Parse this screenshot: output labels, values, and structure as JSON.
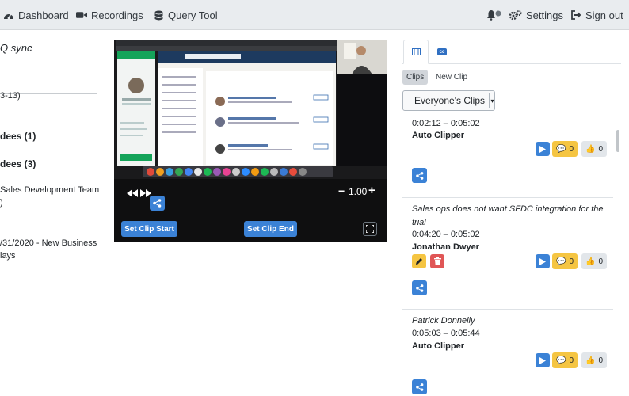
{
  "nav": {
    "dashboard": "Dashboard",
    "recordings": "Recordings",
    "query_tool": "Query Tool",
    "settings": "Settings",
    "sign_out": "Sign out"
  },
  "left_panel": {
    "sync_label": "Q sync",
    "date_range": "3-13)",
    "attendees_1": "dees (1)",
    "attendees_3": "dees (3)",
    "team": "Sales Development Team",
    "team_cont": ")",
    "opportunity": "/31/2020 - New Business",
    "opportunity_cont": "lays"
  },
  "player": {
    "speed": "1.00",
    "set_clip_start": "Set Clip Start",
    "set_clip_end": "Set Clip End"
  },
  "right_panel": {
    "tabs": [
      "clips-tab",
      "captions-tab"
    ],
    "captions_tab_label": "cc",
    "pill_clips": "Clips",
    "pill_new_clip": "New Clip",
    "filter_selected": "Everyone's Clips",
    "clips": [
      {
        "note": "",
        "time": "0:02:12 – 0:05:02",
        "author": "Auto Clipper",
        "comments": "0",
        "likes": "0"
      },
      {
        "note": "Sales ops does not want SFDC integration for the trial",
        "time": "0:04:20 – 0:05:02",
        "author": "Jonathan Dwyer",
        "comments": "0",
        "likes": "0"
      },
      {
        "note": "Patrick Donnelly",
        "time": "0:05:03 – 0:05:44",
        "author": "Auto Clipper",
        "comments": "0",
        "likes": "0"
      }
    ]
  },
  "colors": {
    "accent": "#3b82d6",
    "warning": "#f5c542",
    "danger": "#e05656"
  }
}
